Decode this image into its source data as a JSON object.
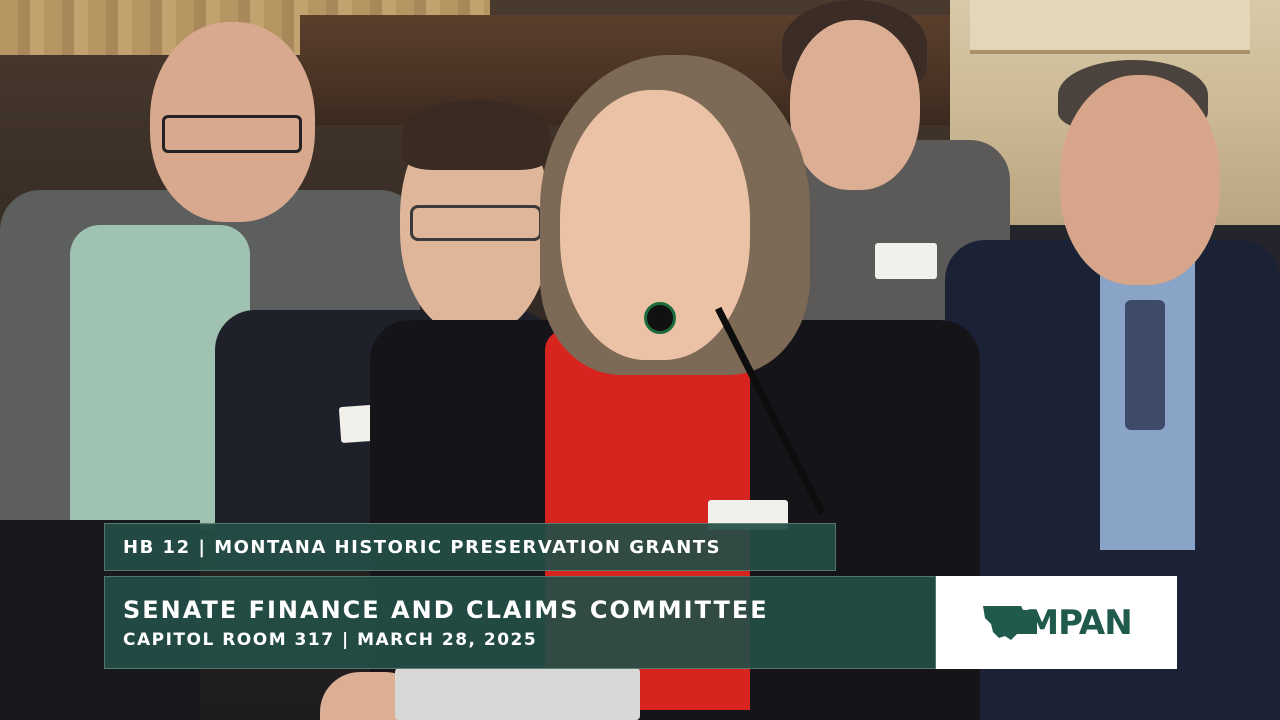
{
  "lower_third": {
    "bill_line": "HB 12 | MONTANA HISTORIC PRESERVATION GRANTS",
    "committee": "SENATE FINANCE AND CLAIMS COMMITTEE",
    "location_date": "CAPITOL ROOM 317 | MARCH 28, 2025"
  },
  "logo": {
    "text": "MPAN",
    "icon": "montana-state-outline-icon",
    "color": "#1f5a4c"
  },
  "colors": {
    "banner_bg": "#244e46",
    "banner_text": "#ffffff",
    "presenter_shirt": "#d8241f"
  }
}
